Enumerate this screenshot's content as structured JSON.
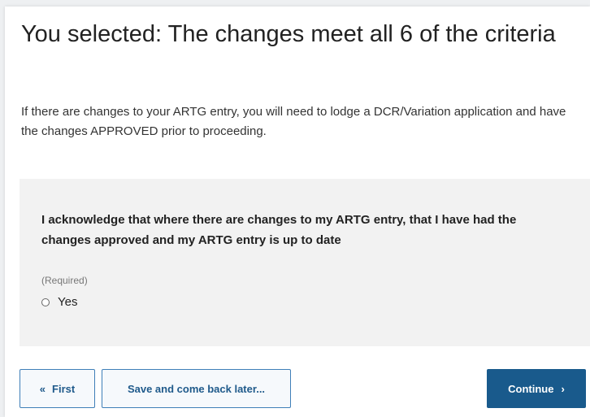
{
  "heading": "You selected: The changes meet all 6 of the criteria",
  "intro": "If there are changes to your ARTG entry, you will need to lodge a DCR/Variation application and have the changes APPROVED prior to proceeding.",
  "question": {
    "text": "I acknowledge that where there are changes to my ARTG entry, that I have had the changes approved and my ARTG entry is up to date",
    "required_label": "(Required)",
    "options": [
      {
        "label": "Yes",
        "selected": false
      }
    ]
  },
  "buttons": {
    "first_icon": "«",
    "first_label": "First",
    "save_label": "Save and come back later...",
    "continue_label": "Continue",
    "continue_icon": "›"
  },
  "colors": {
    "primary": "#195a8c",
    "secondary_border": "#3f7fb8",
    "panel_bg": "#f2f2f2"
  }
}
